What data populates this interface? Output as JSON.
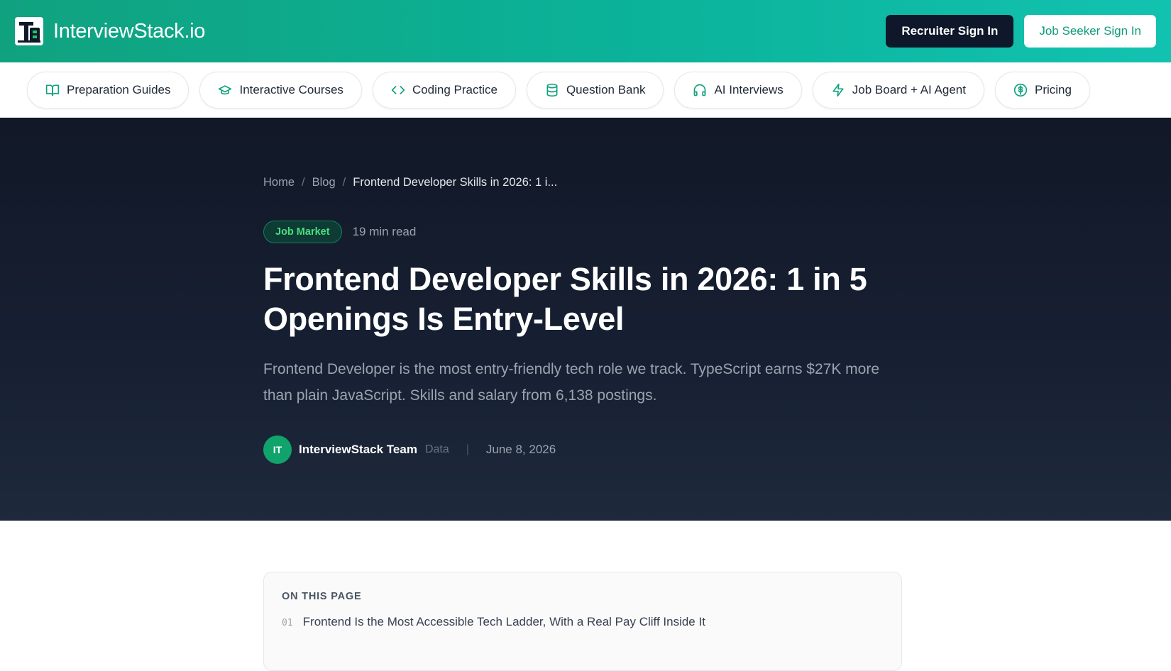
{
  "header": {
    "brand": "InterviewStack.io",
    "recruiter_sign_in": "Recruiter Sign In",
    "job_seeker_sign_in": "Job Seeker Sign In"
  },
  "nav": {
    "items": [
      {
        "label": "Preparation Guides",
        "icon": "book-open-icon"
      },
      {
        "label": "Interactive Courses",
        "icon": "graduation-cap-icon"
      },
      {
        "label": "Coding Practice",
        "icon": "code-icon"
      },
      {
        "label": "Question Bank",
        "icon": "database-icon"
      },
      {
        "label": "AI Interviews",
        "icon": "headphones-icon"
      },
      {
        "label": "Job Board + AI Agent",
        "icon": "lightning-icon"
      },
      {
        "label": "Pricing",
        "icon": "dollar-circle-icon"
      }
    ]
  },
  "breadcrumb": {
    "home": "Home",
    "blog": "Blog",
    "current": "Frontend Developer Skills in 2026: 1 i..."
  },
  "article": {
    "tag": "Job Market",
    "read_time": "19 min read",
    "title": "Frontend Developer Skills in 2026: 1 in 5 Openings Is Entry-Level",
    "subtitle": "Frontend Developer is the most entry-friendly tech role we track. TypeScript earns $27K more than plain JavaScript. Skills and salary from 6,138 postings.",
    "author_initials": "IT",
    "author_name": "InterviewStack Team",
    "author_role": "Data",
    "separator": "|",
    "date": "June 8, 2026"
  },
  "toc": {
    "title": "ON THIS PAGE",
    "items": [
      {
        "num": "01",
        "text": "Frontend Is the Most Accessible Tech Ladder, With a Real Pay Cliff Inside It"
      }
    ]
  },
  "colors": {
    "brand_green": "#10a27f",
    "hero_bg": "#111827",
    "tag_green": "#4ade80",
    "avatar_green": "#10a36b"
  }
}
